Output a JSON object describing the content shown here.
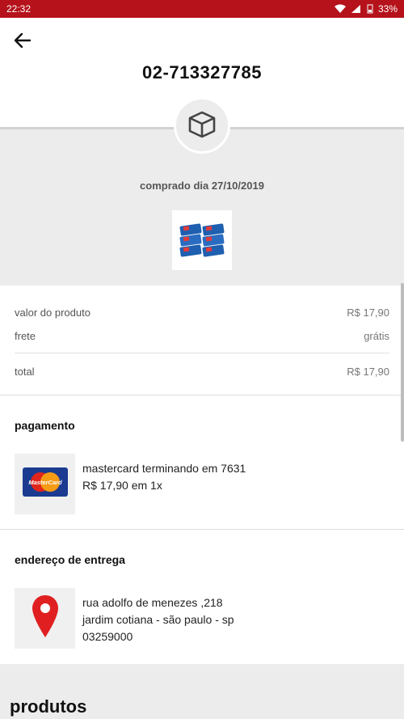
{
  "status_bar": {
    "time": "22:32",
    "battery": "33%"
  },
  "header": {
    "order_number": "02-713327785"
  },
  "purchase": {
    "date_text": "comprado dia 27/10/2019"
  },
  "summary": {
    "product_value_label": "valor do produto",
    "product_value": "R$ 17,90",
    "shipping_label": "frete",
    "shipping_value": "grátis",
    "total_label": "total",
    "total_value": "R$ 17,90"
  },
  "payment": {
    "title": "pagamento",
    "card_line": "mastercard terminando em 7631",
    "installments": "R$ 17,90 em 1x",
    "card_logo_text": "MasterCard"
  },
  "address": {
    "title": "endereço de entrega",
    "line1": "rua adolfo de menezes ,218",
    "line2": "jardim cotiana - são paulo - sp",
    "zip": "03259000"
  },
  "products": {
    "title": "produtos"
  },
  "colors": {
    "status_bar": "#b5121b",
    "section_bg": "#ececec",
    "pin_red": "#e02020"
  },
  "icons": [
    "wifi-icon",
    "signal-icon",
    "battery-icon",
    "back-arrow-icon",
    "box-icon",
    "mastercard-icon",
    "location-pin-icon"
  ]
}
